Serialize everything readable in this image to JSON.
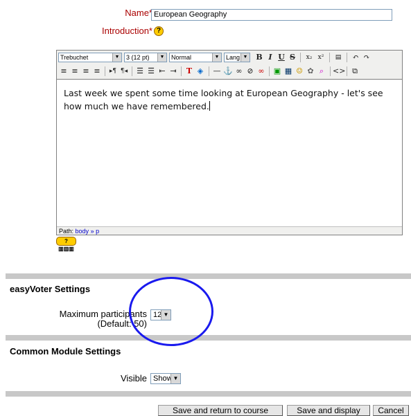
{
  "form": {
    "name_label": "Name*",
    "name_value": "European Geography",
    "intro_label": "Introduction*",
    "help_glyph": "?"
  },
  "editor": {
    "font_family": "Trebuchet",
    "font_size": "3 (12 pt)",
    "format": "Normal",
    "lang": "Lang",
    "content": "Last week we spent some time looking at European Geography - let's see how much we have remembered.",
    "path_label": "Path:",
    "path_body": "body",
    "path_sep": "»",
    "path_p": "p",
    "kbd_help": "? ▥▥▥"
  },
  "easyvoter": {
    "title": "easyVoter Settings",
    "max_label": "Maximum participants",
    "max_default": "(Default: 50)",
    "max_value": "12"
  },
  "common": {
    "title": "Common Module Settings",
    "visible_label": "Visible",
    "visible_value": "Show"
  },
  "buttons": {
    "save_return": "Save and return to course",
    "save_display": "Save and display",
    "cancel": "Cancel"
  },
  "colors": {
    "required_label": "#aa0000",
    "annotation_ring": "#1a1aee"
  }
}
